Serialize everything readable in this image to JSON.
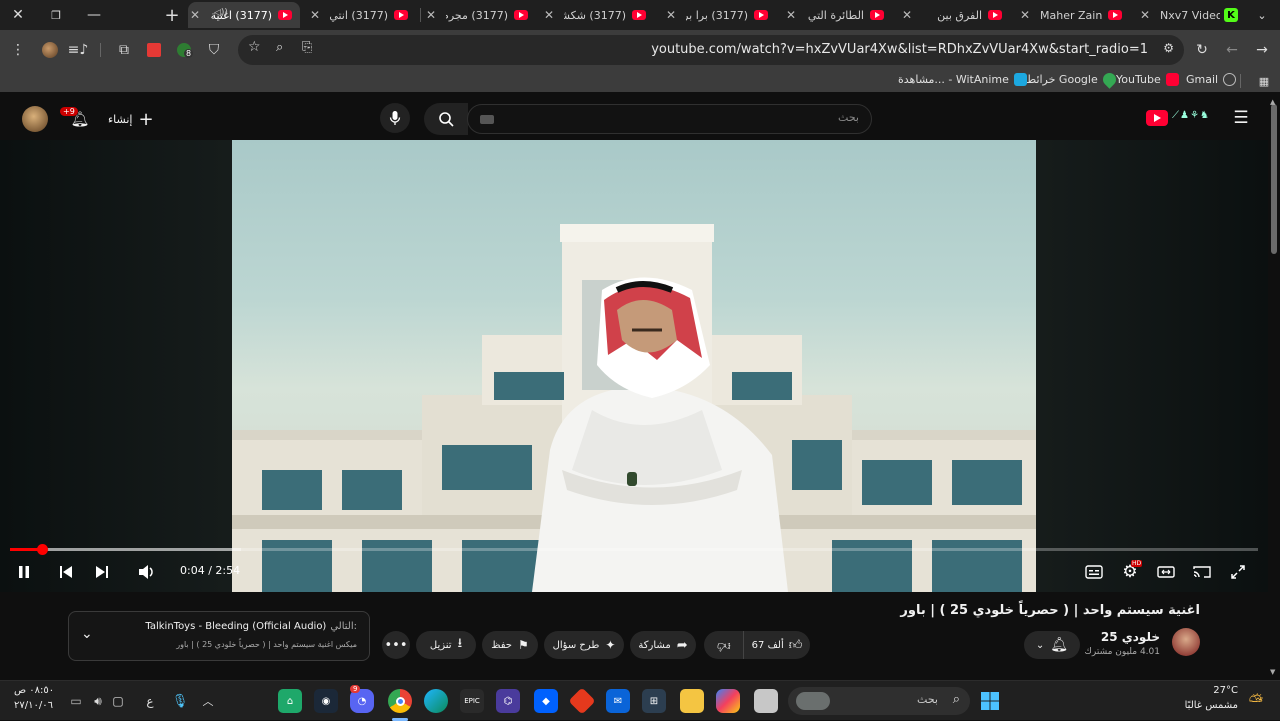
{
  "browser": {
    "tabs": [
      {
        "title": "(3177) اغنية",
        "active": true
      },
      {
        "title": "(3177) انتي"
      },
      {
        "title": "(3177) مجرم"
      },
      {
        "title": "(3177) شكشك"
      },
      {
        "title": "(3177) برا برا"
      },
      {
        "title": "الطائرة التي"
      },
      {
        "title": "الفرق بين"
      },
      {
        "title": "Maher Zain"
      },
      {
        "title": "Nxv7 Videos"
      }
    ],
    "url": "youtube.com/watch?v=hxZvVUar4Xw&list=RDhxZvVUar4Xw&start_radio=1",
    "extension_badge": "8",
    "bookmarks": [
      {
        "label": "Gmail",
        "icon_color": "#d8d8d8"
      },
      {
        "label": "YouTube",
        "icon_color": "#ff0033"
      },
      {
        "label": "خرائط Google",
        "icon_color": "#34a853"
      },
      {
        "label": "مشاهدة... - WitAnime",
        "icon_color": "#1ca8e0"
      }
    ]
  },
  "youtube": {
    "search_placeholder": "بحث",
    "create_label": "إنشاء",
    "notifications_badge": "+9",
    "player": {
      "current_time": "0:04",
      "duration": "2:54",
      "time_display": "0:04 / 2:54",
      "played_fraction": 0.026,
      "buffered_fraction": 0.185,
      "hd_badge": "HD"
    },
    "video_title": "اغنية سيستم واحد | ( حصرياً خلودي 25 ) | باور",
    "channel": {
      "name": "خلودي 25",
      "subscribers": "4.01 مليون مشترك"
    },
    "actions": {
      "likes": "67 ألف",
      "share": "مشاركة",
      "ask": "طرح سؤال",
      "save": "حفظ",
      "download": "تنزيل"
    },
    "up_next": {
      "label": "التالي:",
      "title": "TalkinToys - Bleeding (Official Audio)",
      "mix": "ميكس اغنية سيستم واحد | ( حصرياً خلودي 25 ) | باور"
    }
  },
  "taskbar": {
    "search_placeholder": "بحث",
    "discord_badge": "9",
    "weather_temp": "27°C",
    "weather_desc": "مشمس غالبًا",
    "time": "٠٨:٥٠ ص",
    "date": "٢٧/١٠/٠٦",
    "lang": "ع"
  },
  "colors": {
    "accent": "#ff0000",
    "youtube_red": "#ff0033",
    "chrome_dark": "#1f1f1f"
  }
}
